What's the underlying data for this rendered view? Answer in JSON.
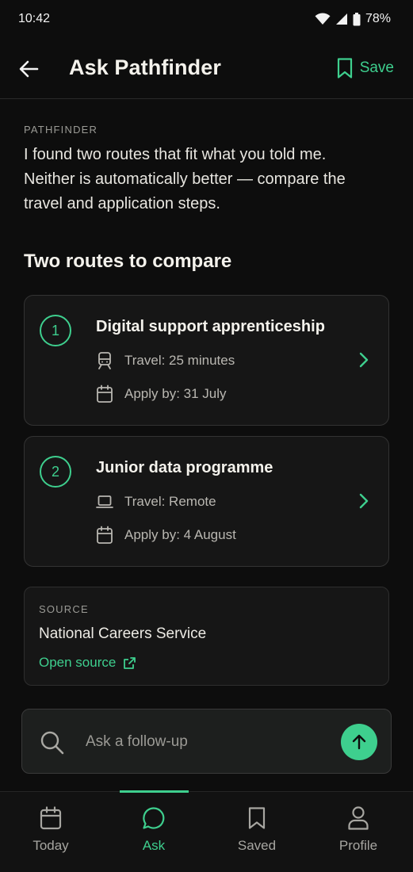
{
  "status_bar": {
    "time": "10:42",
    "battery": "78%"
  },
  "header": {
    "title": "Ask Pathfinder",
    "save_label": "Save"
  },
  "assistant": {
    "label": "PATHFINDER",
    "message": "I found two routes that fit what you told me. Neither is automatically better — compare the travel and application steps."
  },
  "section": {
    "title": "Two routes to compare"
  },
  "routes": [
    {
      "number": "1",
      "title": "Digital support apprenticeship",
      "travel": "Travel: 25 minutes",
      "travel_icon": "train-icon",
      "apply": "Apply by: 31 July"
    },
    {
      "number": "2",
      "title": "Junior data programme",
      "travel": "Travel: Remote",
      "travel_icon": "laptop-icon",
      "apply": "Apply by: 4 August"
    }
  ],
  "source": {
    "label": "SOURCE",
    "name": "National Careers Service",
    "link_label": "Open source"
  },
  "followup": {
    "placeholder": "Ask a follow-up"
  },
  "nav": {
    "items": [
      {
        "label": "Today",
        "icon": "calendar-icon"
      },
      {
        "label": "Ask",
        "icon": "chat-bubble-icon",
        "active": true
      },
      {
        "label": "Saved",
        "icon": "bookmark-icon"
      },
      {
        "label": "Profile",
        "icon": "person-icon"
      }
    ]
  },
  "colors": {
    "accent": "#3ecf8e",
    "background": "#0d0d0d",
    "card": "#161616"
  }
}
